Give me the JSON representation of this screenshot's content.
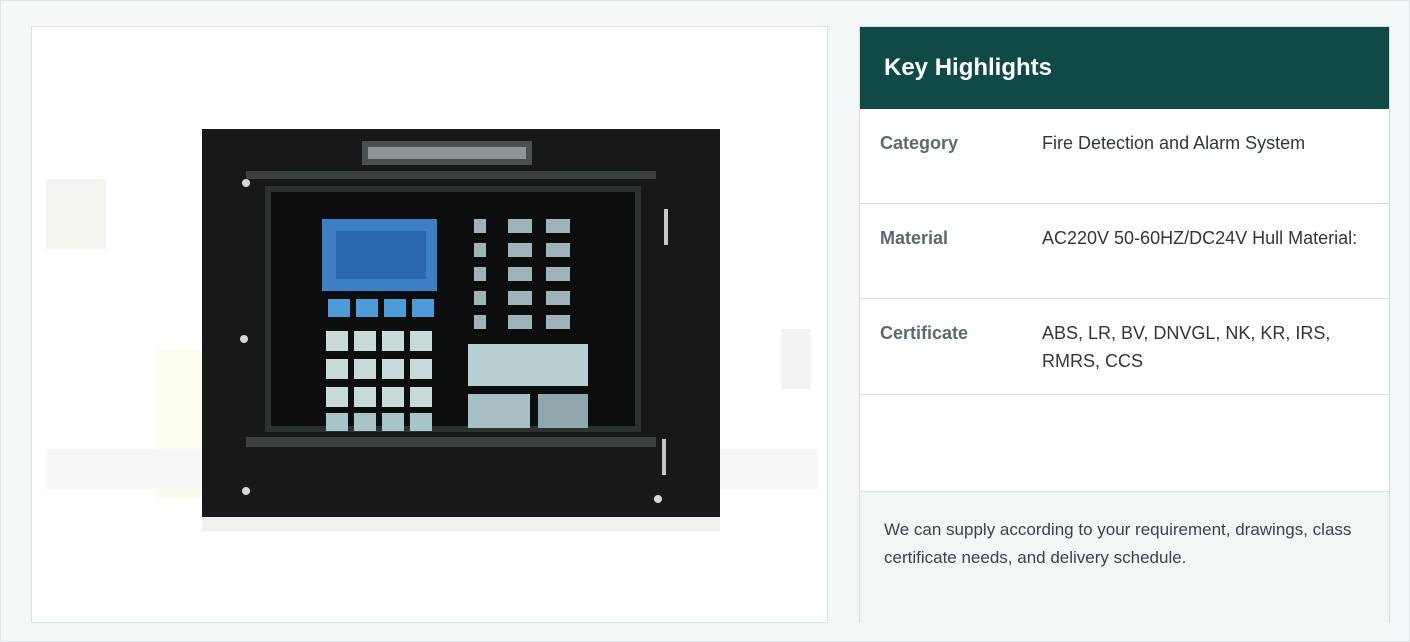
{
  "product_image": {
    "alt": "Fire detection and alarm control panel"
  },
  "highlights": {
    "title": "Key Highlights",
    "rows": [
      {
        "label": "Category",
        "value": "Fire Detection and Alarm System"
      },
      {
        "label": "Material",
        "value": "AC220V 50-60HZ/DC24V Hull Material:"
      },
      {
        "label": "Certificate",
        "value": "ABS, LR, BV, DNVGL, NK, KR, IRS, RMRS, CCS"
      }
    ],
    "note": "We can supply according to your requirement, drawings, class certificate needs, and delivery schedule."
  },
  "colors": {
    "header_bg": "#0f4a47",
    "page_bg": "#f4f7f8",
    "card_border": "#d3e3e3"
  }
}
